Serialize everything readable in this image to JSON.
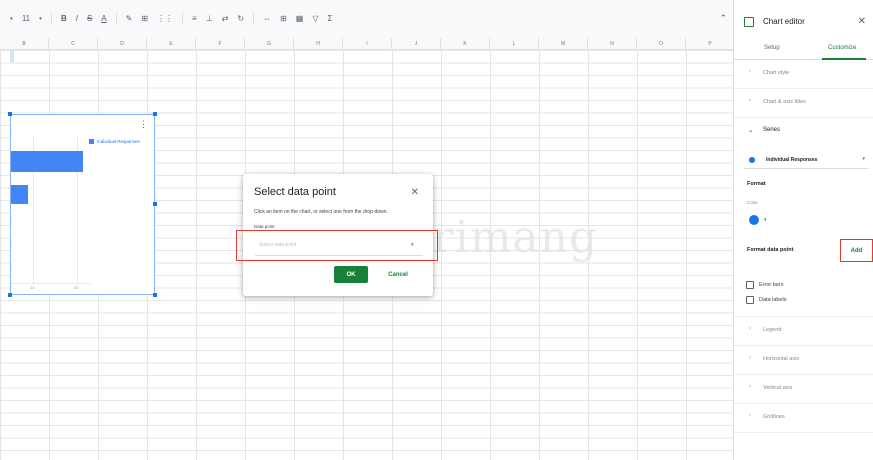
{
  "toolbar": {
    "items": [
      "•",
      "11",
      "•",
      "B",
      "I",
      "S",
      "A",
      "✎",
      "⊞",
      "⋮⋮",
      "≡",
      "⊥",
      "⇄",
      "↻",
      "⇔",
      "⊞",
      "▦",
      "▽",
      "Σ"
    ],
    "collapse_icon": "chevron-up-icon"
  },
  "columns": [
    "B",
    "C",
    "D",
    "E",
    "F",
    "G",
    "H",
    "I",
    "J",
    "K",
    "L",
    "M",
    "N",
    "O",
    "P",
    "Q"
  ],
  "chart": {
    "legend_label": "Individual Responses",
    "menu_icon": "⋮",
    "ticks": [
      "10",
      "20"
    ],
    "bars": [
      0.5,
      0.12
    ]
  },
  "dialog": {
    "title": "Select data point",
    "description": "Click an item on the chart, or select one from the drop-down.",
    "field_label": "Data point",
    "placeholder": "Select data point",
    "ok_label": "OK",
    "cancel_label": "Cancel"
  },
  "watermark": {
    "text": "uantrimang"
  },
  "panel": {
    "title": "Chart editor",
    "tabs": {
      "setup": "Setup",
      "customize": "Customize"
    },
    "sections_top": [
      "Chart style",
      "Chart & axis titles"
    ],
    "series": {
      "header": "Series",
      "selected": "Individual Responses",
      "format_label": "Format",
      "color_label": "Color",
      "format_data_point": "Format data point",
      "add_label": "Add",
      "error_bars": "Error bars",
      "data_labels": "Data labels"
    },
    "sections_bottom": [
      "Legend",
      "Horizontal axis",
      "Vertical axis",
      "Gridlines"
    ],
    "accent_color": "#188038",
    "series_color": "#1a73e8"
  }
}
